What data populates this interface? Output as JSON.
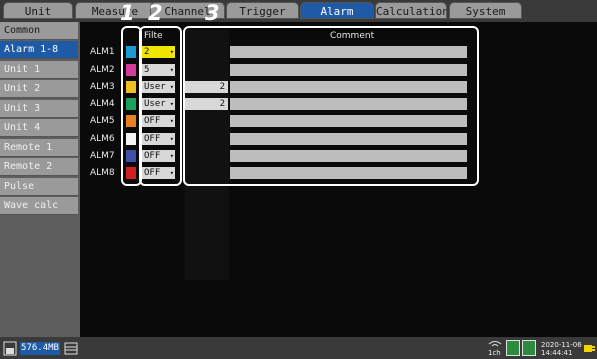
{
  "tabs": [
    {
      "label": "Unit"
    },
    {
      "label": "Measure"
    },
    {
      "label": "Channel"
    },
    {
      "label": "Trigger"
    },
    {
      "label": "Alarm"
    },
    {
      "label": "Calculation"
    },
    {
      "label": "System"
    }
  ],
  "sidebar": {
    "items": [
      {
        "label": "Common"
      },
      {
        "label": "Alarm 1-8"
      },
      {
        "label": "Unit 1"
      },
      {
        "label": "Unit 2"
      },
      {
        "label": "Unit 3"
      },
      {
        "label": "Unit 4"
      },
      {
        "label": "Remote 1"
      },
      {
        "label": "Remote 2"
      },
      {
        "label": "Pulse"
      },
      {
        "label": "Wave calc"
      }
    ]
  },
  "table": {
    "filter_header": "Filte",
    "comment_header": "Comment",
    "rows": [
      {
        "label": "ALM1",
        "color": "#1c9ad6",
        "filter": "2",
        "value": ""
      },
      {
        "label": "ALM2",
        "color": "#d43c9c",
        "filter": "5",
        "value": ""
      },
      {
        "label": "ALM3",
        "color": "#f0c020",
        "filter": "User",
        "value": "2"
      },
      {
        "label": "ALM4",
        "color": "#1aa05a",
        "filter": "User",
        "value": "2"
      },
      {
        "label": "ALM5",
        "color": "#e88020",
        "filter": "OFF",
        "value": ""
      },
      {
        "label": "ALM6",
        "color": "#f4f4f4",
        "filter": "OFF",
        "value": ""
      },
      {
        "label": "ALM7",
        "color": "#4050a8",
        "filter": "OFF",
        "value": ""
      },
      {
        "label": "ALM8",
        "color": "#d02020",
        "filter": "OFF",
        "value": ""
      }
    ]
  },
  "callouts": [
    "1",
    "2",
    "3"
  ],
  "status": {
    "memory": "576.4MB",
    "channel": "1ch",
    "date": "2020-11-06",
    "time": "14:44:41"
  }
}
